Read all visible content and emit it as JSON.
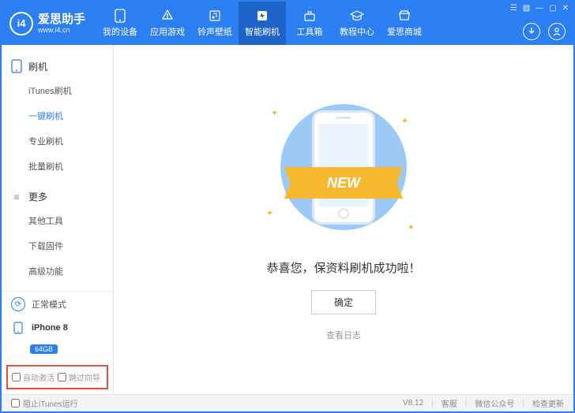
{
  "app": {
    "name": "爱思助手",
    "url": "www.i4.cn"
  },
  "nav": [
    {
      "label": "我的设备",
      "icon": "phone"
    },
    {
      "label": "应用游戏",
      "icon": "apps"
    },
    {
      "label": "铃声壁纸",
      "icon": "music"
    },
    {
      "label": "智能刷机",
      "icon": "flash",
      "active": true
    },
    {
      "label": "工具箱",
      "icon": "toolbox"
    },
    {
      "label": "教程中心",
      "icon": "grad"
    },
    {
      "label": "爱思商城",
      "icon": "store"
    }
  ],
  "sidebar": {
    "sections": [
      {
        "title": "刷机",
        "icon": "phone-rect",
        "items": [
          "iTunes刷机",
          "一键刷机",
          "专业刷机",
          "批量刷机"
        ],
        "activeIndex": 1
      },
      {
        "title": "更多",
        "icon": "hamburger",
        "items": [
          "其他工具",
          "下载固件",
          "高级功能"
        ]
      }
    ],
    "mode": "正常模式",
    "device": {
      "name": "iPhone 8",
      "capacity": "64GB"
    },
    "opts": {
      "auto_activate": "自动激活",
      "skip_guide": "跳过向导"
    }
  },
  "main": {
    "ribbon": "NEW",
    "success": "恭喜您，保资料刷机成功啦！",
    "ok": "确定",
    "log": "查看日志"
  },
  "footer": {
    "block_itunes": "阻止iTunes运行",
    "version": "V8.12",
    "support": "客服",
    "wechat": "微信公众号",
    "update": "检查更新"
  }
}
